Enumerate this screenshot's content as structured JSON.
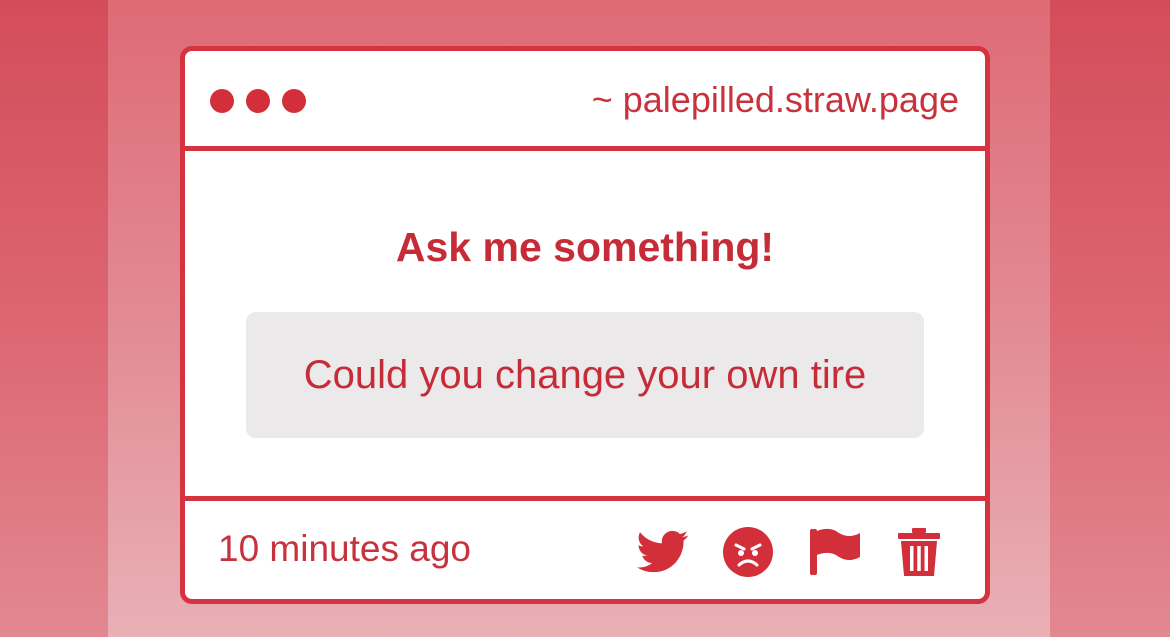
{
  "window": {
    "url": "~ palepilled.straw.page"
  },
  "card": {
    "prompt_title": "Ask me something!",
    "question": "Could you change your own tire"
  },
  "footer": {
    "timestamp": "10 minutes ago",
    "actions": [
      "twitter-icon",
      "angry-face-icon",
      "flag-icon",
      "trash-icon"
    ]
  },
  "colors": {
    "accent": "#d32f3a",
    "question_bg": "#ebe9ea",
    "card_bg": "#ffffff"
  }
}
